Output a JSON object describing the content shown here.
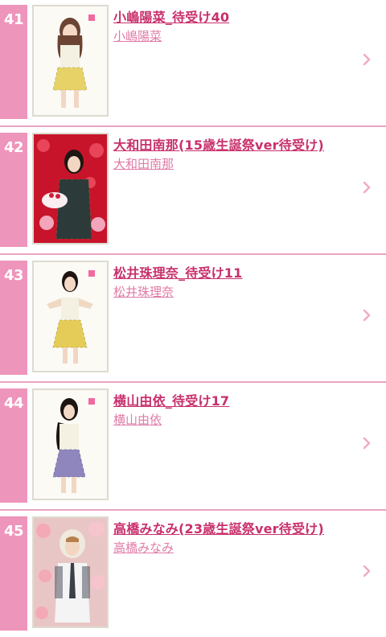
{
  "items": [
    {
      "rank": "41",
      "title": "小嶋陽菜_待受け40",
      "artist": "小嶋陽菜",
      "thumb_icon": "member-photo-icon"
    },
    {
      "rank": "42",
      "title": "大和田南那(15歳生誕祭ver待受け)",
      "artist": "大和田南那",
      "thumb_icon": "member-photo-icon"
    },
    {
      "rank": "43",
      "title": "松井珠理奈_待受け11",
      "artist": "松井珠理奈",
      "thumb_icon": "member-photo-icon"
    },
    {
      "rank": "44",
      "title": "横山由依_待受け17",
      "artist": "横山由依",
      "thumb_icon": "member-photo-icon"
    },
    {
      "rank": "45",
      "title": "高橋みなみ(23歳生誕祭ver待受け)",
      "artist": "高橋みなみ",
      "thumb_icon": "member-photo-icon"
    }
  ],
  "colors": {
    "rank_bg": "#ee95bb",
    "title": "#c8306c",
    "artist": "#e07aa6",
    "divider": "#e7a4c0",
    "chevron": "#f0a9c6"
  }
}
